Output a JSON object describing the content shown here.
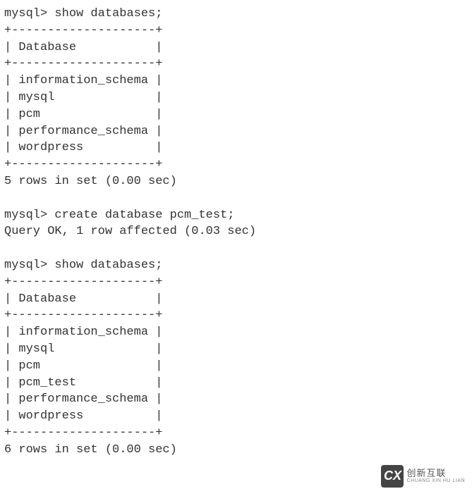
{
  "terminal": {
    "prompt": "mysql>",
    "cmd1": "show databases;",
    "border_top1": "+--------------------+",
    "header1": "| Database           |",
    "border_mid1": "+--------------------+",
    "row1_1": "| information_schema |",
    "row1_2": "| mysql              |",
    "row1_3": "| pcm                |",
    "row1_4": "| performance_schema |",
    "row1_5": "| wordpress          |",
    "border_bot1": "+--------------------+",
    "result1": "5 rows in set (0.00 sec)",
    "cmd2": "create database pcm_test;",
    "result2": "Query OK, 1 row affected (0.03 sec)",
    "cmd3": "show databases;",
    "border_top2": "+--------------------+",
    "header2": "| Database           |",
    "border_mid2": "+--------------------+",
    "row2_1": "| information_schema |",
    "row2_2": "| mysql              |",
    "row2_3": "| pcm                |",
    "row2_4": "| pcm_test           |",
    "row2_5": "| performance_schema |",
    "row2_6": "| wordpress          |",
    "border_bot2": "+--------------------+",
    "result3": "6 rows in set (0.00 sec)"
  },
  "watermark": {
    "logo": "CX",
    "zh": "创新互联",
    "en": "CHUANG XIN HU LIAN"
  }
}
